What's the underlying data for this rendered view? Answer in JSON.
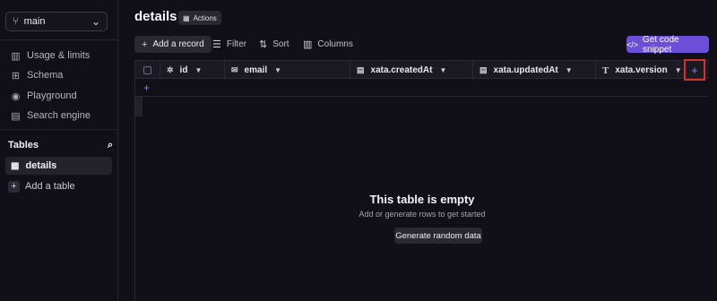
{
  "sidebar": {
    "branch": {
      "label": "main",
      "icon": "git-branch-icon"
    },
    "nav": [
      {
        "label": "Usage & limits",
        "icon": "chart-icon"
      },
      {
        "label": "Schema",
        "icon": "schema-icon"
      },
      {
        "label": "Playground",
        "icon": "playground-icon"
      },
      {
        "label": "Search engine",
        "icon": "search-engine-icon"
      }
    ],
    "tables_header": "Tables",
    "tables": [
      {
        "label": "details",
        "icon": "table-grid-icon"
      }
    ],
    "add_table": "Add a table"
  },
  "main": {
    "title": "details",
    "actions": "Actions",
    "toolbar": {
      "add_record": "Add a record",
      "filter": "Filter",
      "sort": "Sort",
      "columns": "Columns",
      "code_snippet": "Get code snippet"
    },
    "columns": [
      {
        "label": "id",
        "icon": "id-icon"
      },
      {
        "label": "email",
        "icon": "email-icon"
      },
      {
        "label": "xata.createdAt",
        "icon": "calendar-icon"
      },
      {
        "label": "xata.updatedAt",
        "icon": "calendar-icon"
      },
      {
        "label": "xata.version",
        "icon": "text-icon"
      }
    ],
    "empty": {
      "title": "This table is empty",
      "subtitle": "Add or generate rows to get started",
      "button": "Generate random data"
    }
  },
  "colors": {
    "background": "#111018",
    "accent": "#6b4fd8",
    "highlight": "#d5322b"
  }
}
